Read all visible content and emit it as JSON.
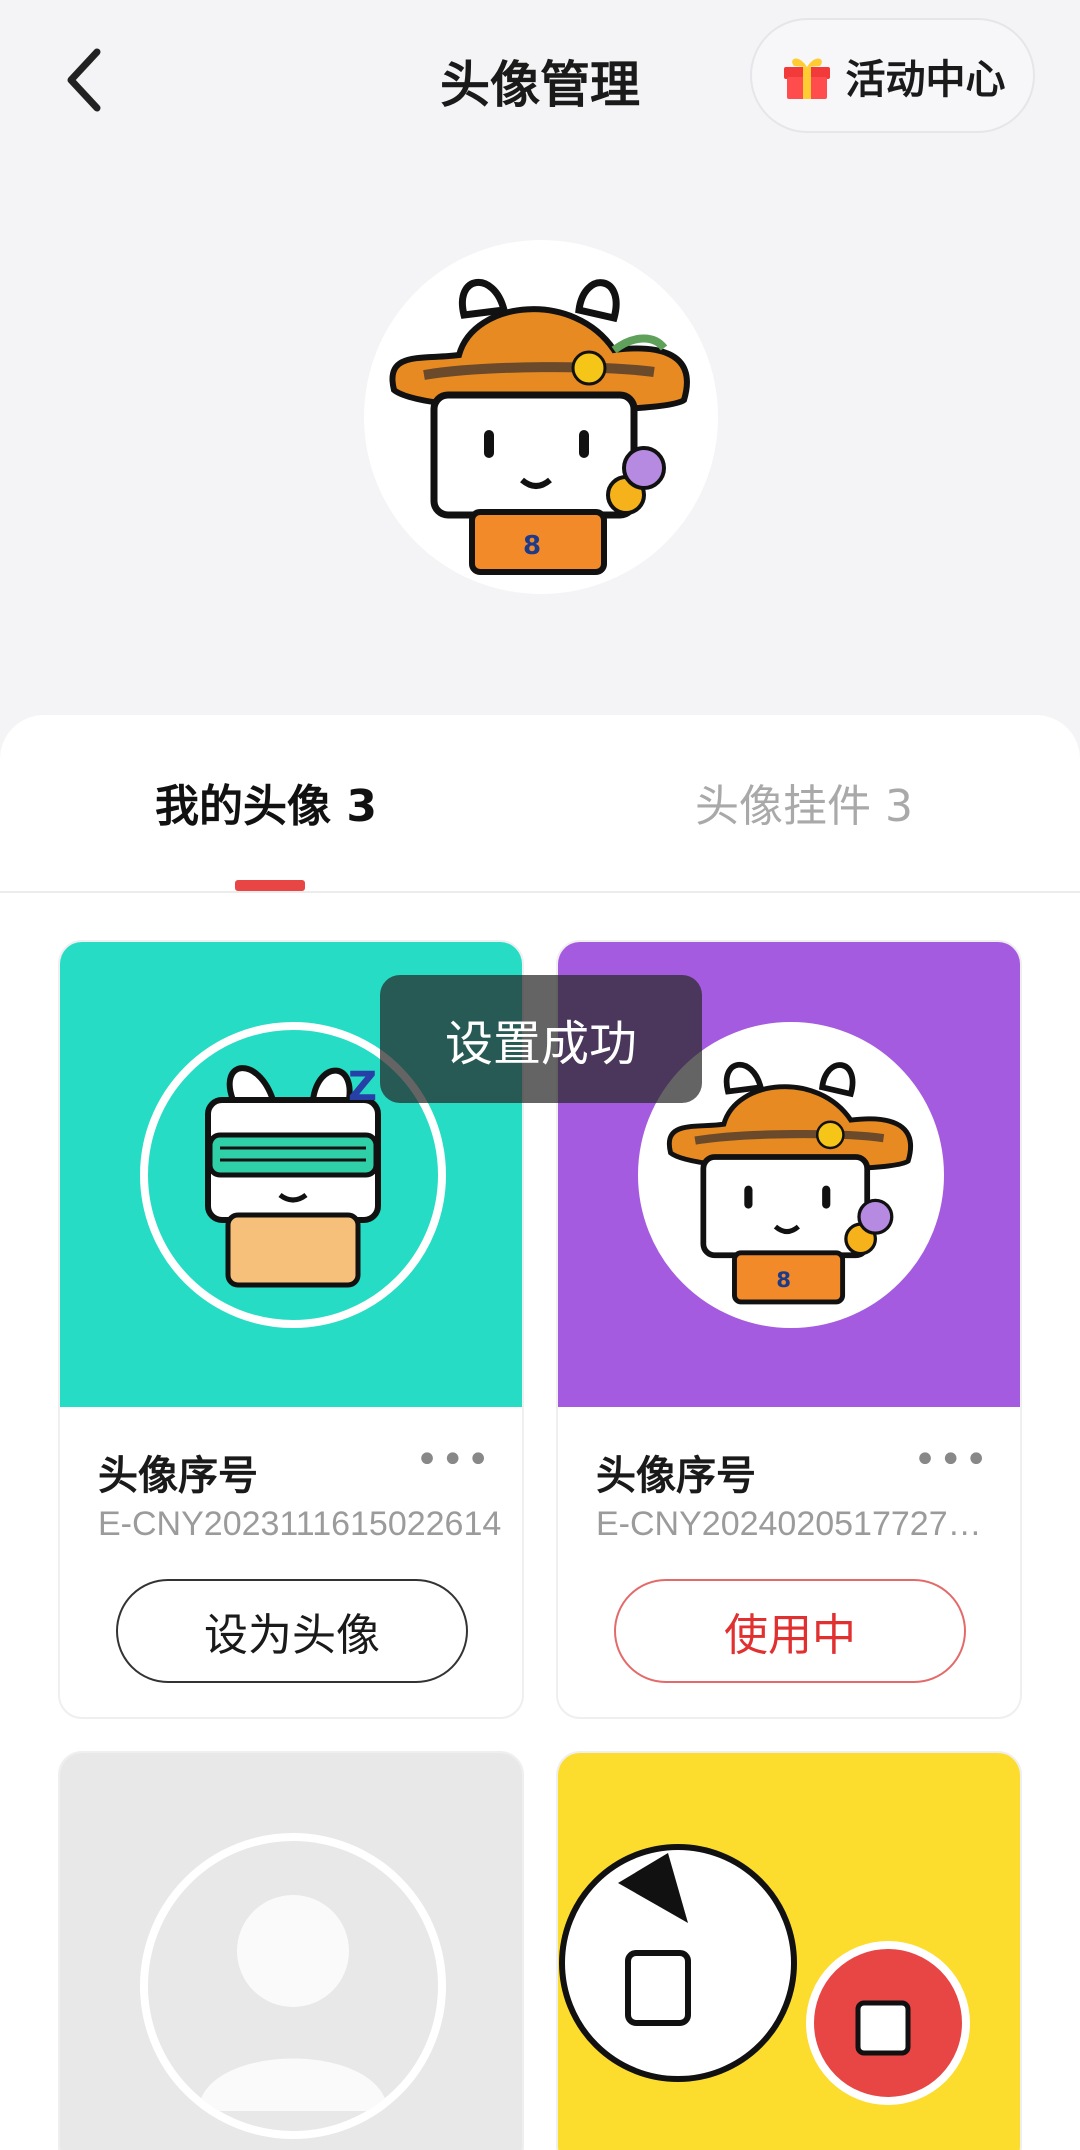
{
  "header": {
    "title": "头像管理",
    "activity_label": "活动中心"
  },
  "tabs": [
    {
      "label": "我的头像 3",
      "active": true
    },
    {
      "label": "头像挂件 3",
      "active": false
    }
  ],
  "cards": [
    {
      "label": "头像序号",
      "serial": "E-CNY2023111615022614",
      "button": "设为头像",
      "bg": "#26dcc4"
    },
    {
      "label": "头像序号",
      "serial": "E-CNY2024020517727…",
      "button": "使用中",
      "bg": "#a45be0"
    },
    {
      "bg": "#e8e8e8"
    },
    {
      "bg": "#fcdc2c"
    }
  ],
  "toast": "设置成功",
  "colors": {
    "accent": "#e84545",
    "inuse": "#e0302f"
  }
}
